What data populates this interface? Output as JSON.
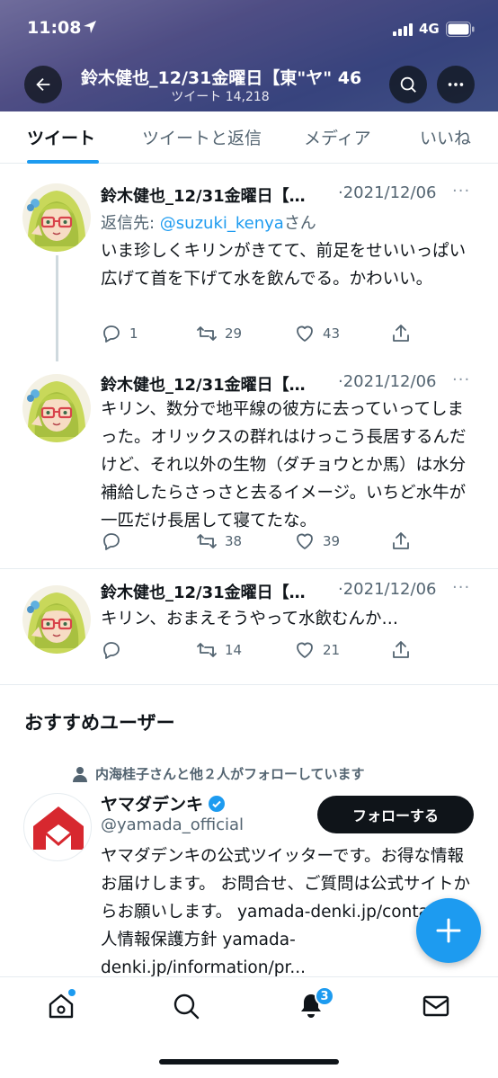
{
  "status_bar": {
    "time": "11:08",
    "network": "4G"
  },
  "header": {
    "profile_name": "鈴木健也_12/31金曜日【東\"ヤ\" 46",
    "tweet_count": "ツイート 14,218"
  },
  "tabs": [
    {
      "label": "ツイート",
      "active": true
    },
    {
      "label": "ツイートと返信",
      "active": false
    },
    {
      "label": "メディア",
      "active": false
    },
    {
      "label": "いいね",
      "active": false
    }
  ],
  "tweets": [
    {
      "name": "鈴木健也_12/31金曜日【…",
      "date": "·2021/12/06",
      "reply_prefix": "返信先: ",
      "reply_handle": "@suzuki_kenya",
      "reply_suffix": "さん",
      "text": "いま珍しくキリンがきてて、前足をせいいっぱい広げて首を下げて水を飲んでる。かわいい。",
      "replies": "1",
      "retweets": "29",
      "likes": "43"
    },
    {
      "name": "鈴木健也_12/31金曜日【…",
      "date": "·2021/12/06",
      "text": "キリン、数分で地平線の彼方に去っていってしまった。オリックスの群れはけっこう長居するんだけど、それ以外の生物（ダチョウとか馬）は水分補給したらさっさと去るイメージ。いちど水牛が一匹だけ長居して寝てたな。",
      "replies": "",
      "retweets": "38",
      "likes": "39"
    },
    {
      "name": "鈴木健也_12/31金曜日【…",
      "date": "·2021/12/06",
      "text": "キリン、おまえそうやって水飲むんか…",
      "replies": "",
      "retweets": "14",
      "likes": "21"
    }
  ],
  "recommended": {
    "title": "おすすめユーザー",
    "social_context": "内海桂子さんと他２人がフォローしています",
    "name": "ヤマダデンキ",
    "handle": "@yamada_official",
    "follow_label": "フォローする",
    "bio": "ヤマダデンキの公式ツイッターです。お得な情報お届けします。 お問合せ、ご質問は公式サイトからお願いします。 yamada-denki.jp/contact/個人情報保護方針 yamada-denki.jp/information/pr...",
    "logo_color": "#d7282f"
  },
  "bottom_nav": {
    "notifications_badge": "3"
  },
  "colors": {
    "accent": "#1d9bf0",
    "text": "#0f1419",
    "muted": "#536471"
  }
}
